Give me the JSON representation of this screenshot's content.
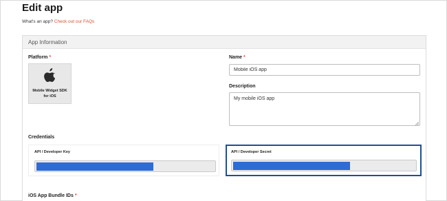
{
  "page": {
    "title": "Edit app",
    "faq_prompt": "What's an app?",
    "faq_link": "Check out our FAQs"
  },
  "panel": {
    "title": "App Information"
  },
  "platform": {
    "label": "Platform",
    "required_mark": "*",
    "tile_label_line1": "Mobile Widget SDK",
    "tile_label_line2": "for iOS",
    "icon": "apple-icon"
  },
  "name": {
    "label": "Name",
    "required_mark": "*",
    "value": "Mobile iOS app"
  },
  "description": {
    "label": "Description",
    "value": "My mobile iOS app"
  },
  "credentials": {
    "label": "Credentials",
    "key_label": "API / Developer Key",
    "secret_label": "API / Developer Secret"
  },
  "bundle_ids": {
    "label": "iOS App Bundle IDs",
    "required_mark": "*"
  },
  "colors": {
    "accent_link": "#d9502f",
    "mask_fill": "#2f6bd5",
    "focus_border": "#1f4f8c"
  }
}
